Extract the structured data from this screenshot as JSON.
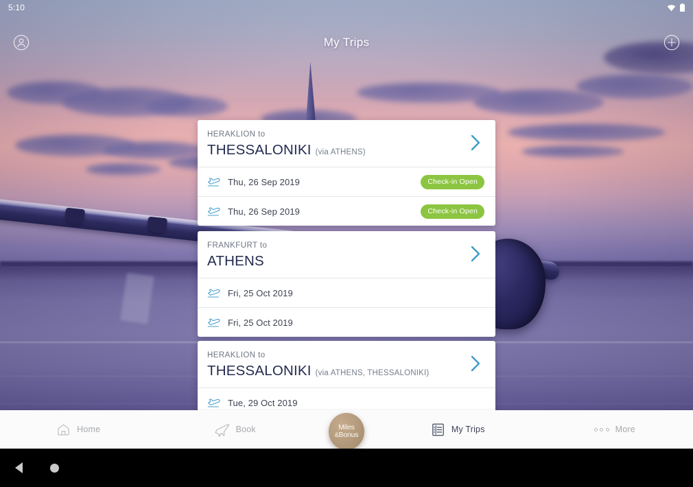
{
  "status_bar": {
    "time": "5:10",
    "wifi_icon": "wifi-icon",
    "battery_icon": "battery-icon"
  },
  "app_bar": {
    "title": "My Trips",
    "left_icon": "account-circle-icon",
    "right_icon": "add-circle-icon"
  },
  "colors": {
    "badge_green": "#8cc541",
    "chevron_blue": "#3d9bc7",
    "flight_icon_blue": "#4a9fd0",
    "title_navy": "#232a4f",
    "miles_tan": "#b49b7d"
  },
  "trips": [
    {
      "from_label": "HERAKLION to",
      "destination": "THESSALONIKI",
      "via": "(via ATHENS)",
      "segments": [
        {
          "icon": "flight-takeoff-icon",
          "date": "Thu, 26 Sep 2019",
          "status": "Check-in Open"
        },
        {
          "icon": "flight-takeoff-icon",
          "date": "Thu, 26 Sep 2019",
          "status": "Check-in Open"
        }
      ]
    },
    {
      "from_label": "FRANKFURT to",
      "destination": "ATHENS",
      "via": "",
      "segments": [
        {
          "icon": "flight-takeoff-icon",
          "date": "Fri, 25 Oct 2019",
          "status": ""
        },
        {
          "icon": "flight-takeoff-icon",
          "date": "Fri, 25 Oct 2019",
          "status": ""
        }
      ]
    },
    {
      "from_label": "HERAKLION to",
      "destination": "THESSALONIKI",
      "via": "(via ATHENS, THESSALONIKI)",
      "segments": [
        {
          "icon": "flight-takeoff-icon",
          "date": "Tue, 29 Oct 2019",
          "status": ""
        }
      ]
    }
  ],
  "bottom_nav": {
    "items": [
      {
        "label": "Home",
        "icon": "home-icon",
        "active": false
      },
      {
        "label": "Book",
        "icon": "airplane-icon",
        "active": false
      },
      {
        "label": "My Trips",
        "icon": "list-icon",
        "active": true
      },
      {
        "label": "More",
        "icon": "more-dots-icon",
        "active": false
      }
    ],
    "center_button": {
      "line1": "Miles",
      "amp": "&",
      "line2": "Bonus"
    }
  },
  "system_bar": {
    "back_icon": "back-triangle-icon",
    "home_icon": "home-circle-icon"
  }
}
